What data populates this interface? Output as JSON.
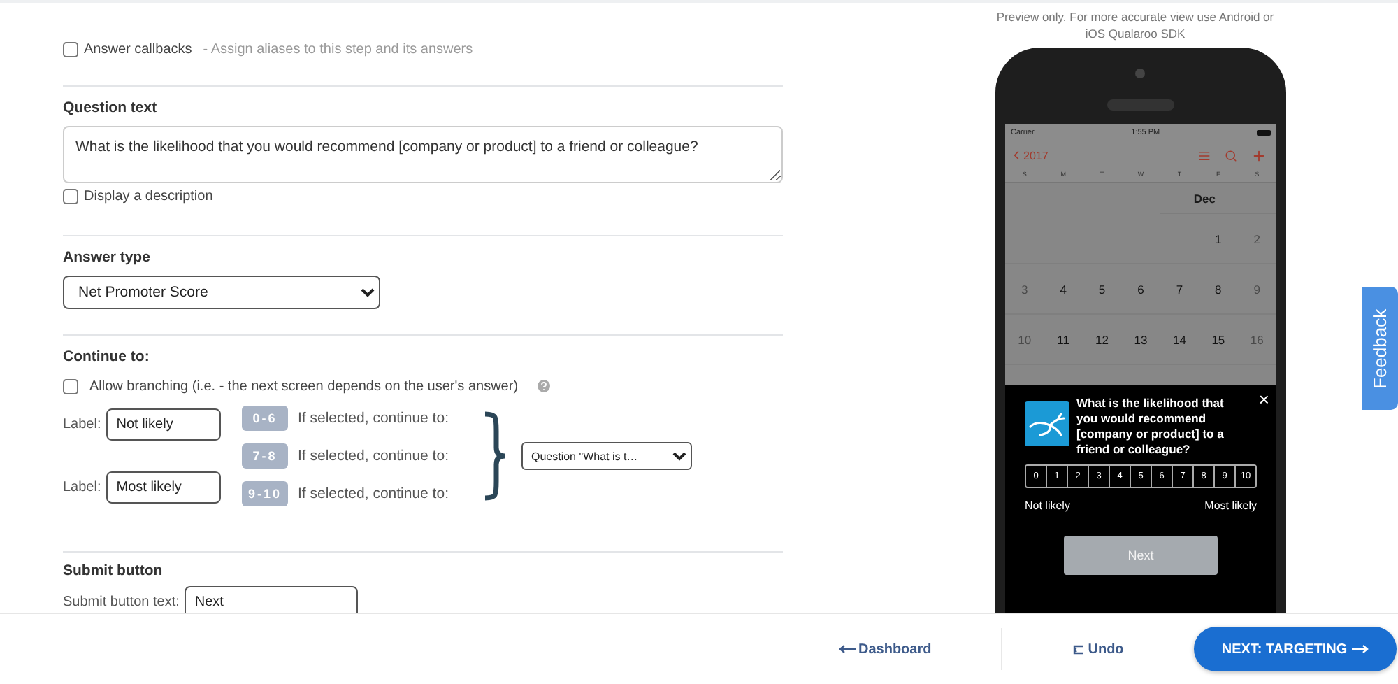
{
  "answer_callbacks": {
    "label": "Answer callbacks",
    "hint": "- Assign aliases to this step and its answers",
    "checked": false
  },
  "question_text": {
    "heading": "Question text",
    "value": "What is the likelihood that you would recommend [company or product] to a friend or colleague?",
    "display_description": {
      "label": "Display a description",
      "checked": false
    }
  },
  "answer_type": {
    "heading": "Answer type",
    "value": "Net Promoter Score"
  },
  "continue_to": {
    "heading": "Continue to:",
    "allow_branching": {
      "label": "Allow branching (i.e. - the next screen depends on the user's answer)",
      "checked": false
    },
    "labels": [
      {
        "caption": "Label:",
        "value": "Not likely"
      },
      {
        "caption": "Label:",
        "value": "Most likely"
      }
    ],
    "ranges": [
      {
        "badge": "0-6",
        "text": "If selected, continue to:"
      },
      {
        "badge": "7-8",
        "text": "If selected, continue to:"
      },
      {
        "badge": "9-10",
        "text": "If selected, continue to:"
      }
    ],
    "destination": "Question \"What is t…"
  },
  "submit_button": {
    "heading": "Submit button",
    "caption": "Submit button text:",
    "value": "Next"
  },
  "preview": {
    "note": "Preview only. For more accurate view use Android or iOS Qualaroo SDK",
    "status": {
      "carrier": "Carrier",
      "time": "1:55 PM"
    },
    "calendar": {
      "back": "2017",
      "weekdays": [
        "S",
        "M",
        "T",
        "W",
        "T",
        "F",
        "S"
      ],
      "month": "Dec",
      "weeks": [
        {
          "kind": "partial",
          "days": [
            {
              "day": "1",
              "muted": false
            },
            {
              "day": "2",
              "muted": true
            }
          ]
        },
        {
          "kind": "full",
          "days": [
            {
              "day": "3",
              "muted": true
            },
            {
              "day": "4",
              "muted": false
            },
            {
              "day": "5",
              "muted": false
            },
            {
              "day": "6",
              "muted": false
            },
            {
              "day": "7",
              "muted": false
            },
            {
              "day": "8",
              "muted": false
            },
            {
              "day": "9",
              "muted": true
            }
          ]
        },
        {
          "kind": "full",
          "days": [
            {
              "day": "10",
              "muted": true
            },
            {
              "day": "11",
              "muted": false
            },
            {
              "day": "12",
              "muted": false
            },
            {
              "day": "13",
              "muted": false
            },
            {
              "day": "14",
              "muted": false
            },
            {
              "day": "15",
              "muted": false
            },
            {
              "day": "16",
              "muted": true
            }
          ]
        }
      ]
    },
    "survey": {
      "question": "What is the likelihood that you would recommend [company or product] to a friend or colleague?",
      "close": "×",
      "scale": [
        "0",
        "1",
        "2",
        "3",
        "4",
        "5",
        "6",
        "7",
        "8",
        "9",
        "10"
      ],
      "low_label": "Not likely",
      "high_label": "Most likely",
      "button": "Next"
    }
  },
  "feedback_tab": "Feedback",
  "footer": {
    "dashboard": "Dashboard",
    "undo": "Undo",
    "next": "NEXT: TARGETING"
  }
}
